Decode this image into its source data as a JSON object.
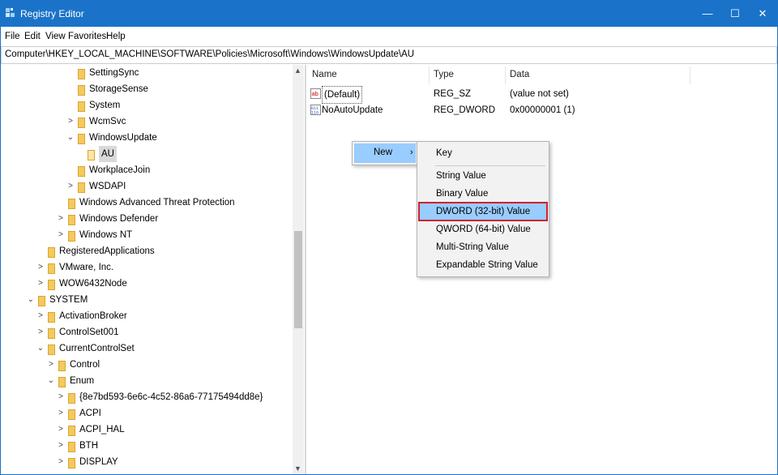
{
  "window": {
    "title": "Registry Editor",
    "controls": [
      "—",
      "☐",
      "✕"
    ]
  },
  "menubar": [
    "File",
    "Edit",
    "View",
    "Favorites",
    "Help"
  ],
  "address": "Computer\\HKEY_LOCAL_MACHINE\\SOFTWARE\\Policies\\Microsoft\\Windows\\WindowsUpdate\\AU",
  "tree": [
    {
      "label": "SettingSync",
      "arrow": ""
    },
    {
      "label": "StorageSense",
      "arrow": ""
    },
    {
      "label": "System",
      "arrow": ""
    },
    {
      "label": "WcmSvc",
      "arrow": ">"
    },
    {
      "label": "WindowsUpdate",
      "arrow": "v"
    },
    {
      "label": "AU",
      "arrow": ""
    },
    {
      "label": "WorkplaceJoin",
      "arrow": ""
    },
    {
      "label": "WSDAPI",
      "arrow": ">"
    },
    {
      "label": "Windows Advanced Threat Protection",
      "arrow": ""
    },
    {
      "label": "Windows Defender",
      "arrow": ">"
    },
    {
      "label": "Windows NT",
      "arrow": ">"
    },
    {
      "label": "RegisteredApplications",
      "arrow": ""
    },
    {
      "label": "VMware, Inc.",
      "arrow": ">"
    },
    {
      "label": "WOW6432Node",
      "arrow": ">"
    },
    {
      "label": "SYSTEM",
      "arrow": "v"
    },
    {
      "label": "ActivationBroker",
      "arrow": ">"
    },
    {
      "label": "ControlSet001",
      "arrow": ">"
    },
    {
      "label": "CurrentControlSet",
      "arrow": "v"
    },
    {
      "label": "Control",
      "arrow": ">"
    },
    {
      "label": "Enum",
      "arrow": "v"
    },
    {
      "label": "{8e7bd593-6e6c-4c52-86a6-77175494dd8e}",
      "arrow": ">"
    },
    {
      "label": "ACPI",
      "arrow": ">"
    },
    {
      "label": "ACPI_HAL",
      "arrow": ">"
    },
    {
      "label": "BTH",
      "arrow": ">"
    },
    {
      "label": "DISPLAY",
      "arrow": ">"
    }
  ],
  "columns": {
    "name": "Name",
    "type": "Type",
    "data": "Data"
  },
  "values": [
    {
      "name": "(Default)",
      "type": "REG_SZ",
      "data": "(value not set)",
      "icon": "string-value-icon"
    },
    {
      "name": "NoAutoUpdate",
      "type": "REG_DWORD",
      "data": "0x00000001 (1)",
      "icon": "binary-value-icon"
    }
  ],
  "context_menu": {
    "new_label": "New",
    "new_arrow": "›",
    "submenu": [
      {
        "label": "Key",
        "highlight": false
      },
      {
        "label": "String Value",
        "highlight": false
      },
      {
        "label": "Binary Value",
        "highlight": false
      },
      {
        "label": "DWORD (32-bit) Value",
        "highlight": true
      },
      {
        "label": "QWORD (64-bit) Value",
        "highlight": false
      },
      {
        "label": "Multi-String Value",
        "highlight": false
      },
      {
        "label": "Expandable String Value",
        "highlight": false
      }
    ]
  },
  "colors": {
    "titlebar": "#1a73c8",
    "menu_hover": "#99ccff",
    "highlight_border": "#d1202f",
    "folder": "#f4c95d"
  }
}
